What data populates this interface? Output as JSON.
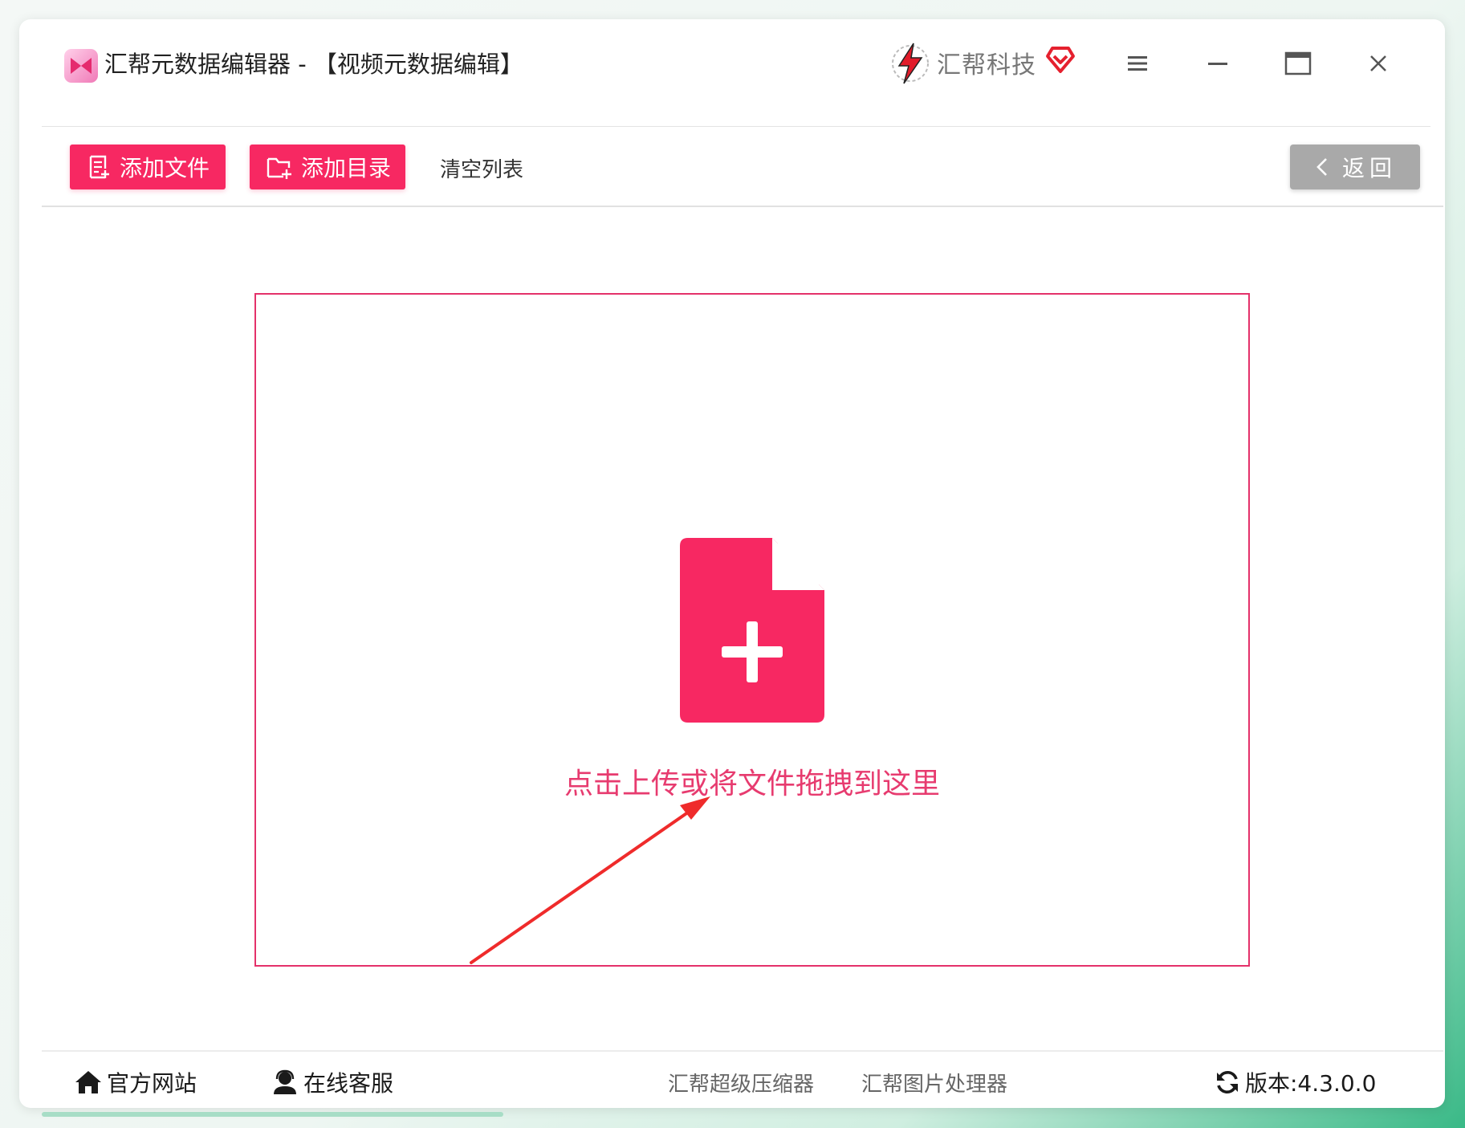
{
  "window": {
    "title": "汇帮元数据编辑器 - 【视频元数据编辑】",
    "brand_name": "汇帮科技",
    "controls": [
      "menu",
      "minimize",
      "maximize",
      "close"
    ]
  },
  "toolbar": {
    "add_file_label": "添加文件",
    "add_folder_label": "添加目录",
    "clear_list_label": "清空列表",
    "back_label": "返回"
  },
  "dropzone": {
    "text": "点击上传或将文件拖拽到这里"
  },
  "footer": {
    "website_label": "官方网站",
    "support_label": "在线客服",
    "compressor_link": "汇帮超级压缩器",
    "image_link": "汇帮图片处理器",
    "version_label": "版本:4.3.0.0"
  },
  "colors": {
    "accent": "#f72862",
    "dropzone_border": "#e4316a",
    "back_button": "#a9a9a9"
  },
  "icons": [
    "app-logo-icon",
    "brand-logo-icon",
    "brand-heart-icon",
    "menu-icon",
    "minimize-icon",
    "maximize-icon",
    "close-icon",
    "add-file-icon",
    "add-folder-icon",
    "chevron-left-icon",
    "file-plus-icon",
    "home-icon",
    "support-agent-icon",
    "refresh-icon"
  ]
}
